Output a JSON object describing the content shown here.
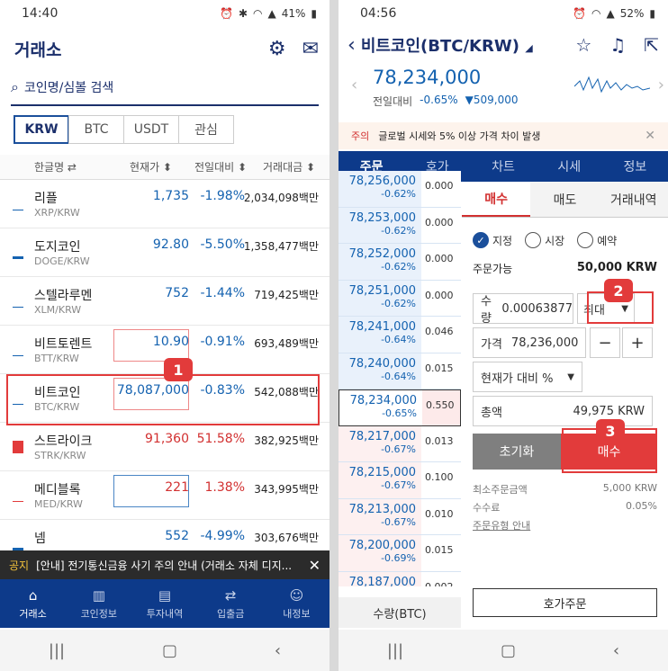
{
  "left": {
    "status": {
      "time": "14:40",
      "battery": "41%"
    },
    "header": {
      "title": "거래소"
    },
    "search": {
      "placeholder": "코인명/심볼 검색"
    },
    "tabs": [
      "KRW",
      "BTC",
      "USDT",
      "관심"
    ],
    "columns": {
      "name": "한글명 ⇄",
      "price": "현재가 ⬍",
      "change": "전일대비 ⬍",
      "volume": "거래대금 ⬍"
    },
    "rows": [
      {
        "name": "리플",
        "symbol": "XRP/KRW",
        "price": "1,735",
        "change": "-1.98%",
        "volume": "2,034,098백만",
        "dir": "dn"
      },
      {
        "name": "도지코인",
        "symbol": "DOGE/KRW",
        "price": "92.80",
        "change": "-5.50%",
        "volume": "1,358,477백만",
        "dir": "dn"
      },
      {
        "name": "스텔라루멘",
        "symbol": "XLM/KRW",
        "price": "752",
        "change": "-1.44%",
        "volume": "719,425백만",
        "dir": "dn"
      },
      {
        "name": "비트토렌트",
        "symbol": "BTT/KRW",
        "price": "10.90",
        "change": "-0.91%",
        "volume": "693,489백만",
        "dir": "dn"
      },
      {
        "name": "비트코인",
        "symbol": "BTC/KRW",
        "price": "78,087,000",
        "change": "-0.83%",
        "volume": "542,088백만",
        "dir": "dn"
      },
      {
        "name": "스트라이크",
        "symbol": "STRK/KRW",
        "price": "91,360",
        "change": "51.58%",
        "volume": "382,925백만",
        "dir": "up"
      },
      {
        "name": "메디블록",
        "symbol": "MED/KRW",
        "price": "221",
        "change": "1.38%",
        "volume": "343,995백만",
        "dir": "up"
      },
      {
        "name": "넴",
        "symbol": "",
        "price": "552",
        "change": "-4.99%",
        "volume": "303,676백만",
        "dir": "dn"
      }
    ],
    "notice": {
      "tag": "공지",
      "text": "[안내] 전기통신금융 사기 주의 안내 (거래소 자체 디지..."
    },
    "bottom_nav": [
      "거래소",
      "코인정보",
      "투자내역",
      "입출금",
      "내정보"
    ],
    "badge": "1"
  },
  "right": {
    "status": {
      "time": "04:56",
      "battery": "52%"
    },
    "header": {
      "title": "비트코인(BTC/KRW)"
    },
    "price": {
      "value": "78,234,000",
      "label": "전일대비",
      "pct": "-0.65%",
      "diff": "▼509,000"
    },
    "warning": {
      "tag": "주의",
      "text": "글로벌 시세와 5% 이상 가격 차이 발생"
    },
    "tabs": [
      "주문",
      "호가",
      "차트",
      "시세",
      "정보"
    ],
    "orderbook": [
      {
        "price": "78,256,000",
        "pct": "-0.62%",
        "qty": "0.000"
      },
      {
        "price": "78,253,000",
        "pct": "-0.62%",
        "qty": "0.000"
      },
      {
        "price": "78,252,000",
        "pct": "-0.62%",
        "qty": "0.000"
      },
      {
        "price": "78,251,000",
        "pct": "-0.62%",
        "qty": "0.000"
      },
      {
        "price": "78,241,000",
        "pct": "-0.64%",
        "qty": "0.046"
      },
      {
        "price": "78,240,000",
        "pct": "-0.64%",
        "qty": "0.015"
      },
      {
        "price": "78,234,000",
        "pct": "-0.65%",
        "qty": "0.550"
      },
      {
        "price": "78,217,000",
        "pct": "-0.67%",
        "qty": "0.013"
      },
      {
        "price": "78,215,000",
        "pct": "-0.67%",
        "qty": "0.100"
      },
      {
        "price": "78,213,000",
        "pct": "-0.67%",
        "qty": "0.010"
      },
      {
        "price": "78,200,000",
        "pct": "-0.69%",
        "qty": "0.015"
      },
      {
        "price": "78,187,000",
        "pct": "",
        "qty": "0.002"
      }
    ],
    "ob_footer": "수량(BTC)",
    "form_tabs": [
      "매수",
      "매도",
      "거래내역"
    ],
    "radios": [
      "지정",
      "시장",
      "예약"
    ],
    "available": {
      "label": "주문가능",
      "value": "50,000 KRW"
    },
    "qty": {
      "label": "수량",
      "value": "0.00063877",
      "max": "최대"
    },
    "order_price": {
      "label": "가격",
      "value": "78,236,000",
      "minus": "−",
      "plus": "+"
    },
    "pct_select": "현재가 대비 %",
    "total": {
      "label": "총액",
      "value": "49,975 KRW"
    },
    "reset": "초기화",
    "buy": "매수",
    "info": [
      {
        "label": "최소주문금액",
        "value": "5,000 KRW"
      },
      {
        "label": "수수료",
        "value": "0.05%"
      },
      {
        "label": "주문유형 안내",
        "value": ""
      }
    ],
    "order_button": "호가주문",
    "badge2": "2",
    "badge3": "3"
  }
}
